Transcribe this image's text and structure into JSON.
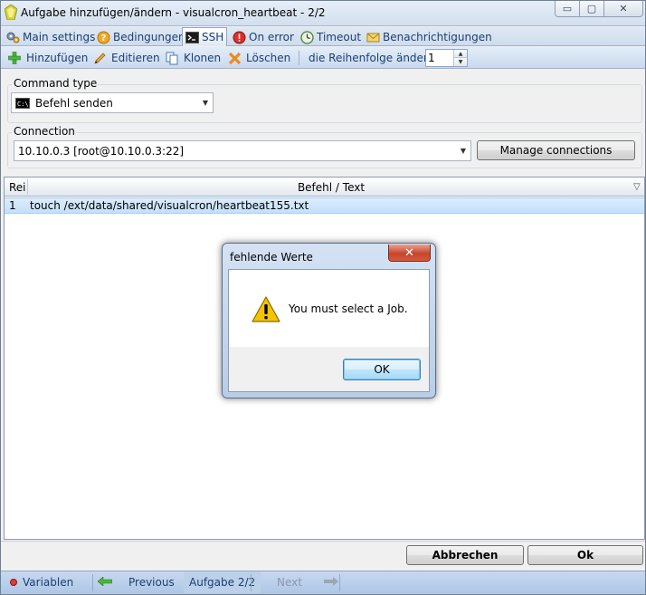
{
  "window": {
    "title": "Aufgabe hinzufügen/ändern - visualcron_heartbeat - 2/2",
    "min_glyph": "▭",
    "max_glyph": "▢",
    "close_glyph": "✕"
  },
  "tabs": [
    {
      "label": "Main settings",
      "icon": "gears-icon"
    },
    {
      "label": "Bedingungen",
      "icon": "question-icon"
    },
    {
      "label": "SSH",
      "icon": "terminal-icon",
      "active": true
    },
    {
      "label": "On error",
      "icon": "error-icon"
    },
    {
      "label": "Timeout",
      "icon": "clock-icon"
    },
    {
      "label": "Benachrichtigungen",
      "icon": "envelope-icon"
    }
  ],
  "toolbar": {
    "add_label": "Hinzufügen",
    "edit_label": "Editieren",
    "clone_label": "Klonen",
    "delete_label": "Löschen",
    "order_label": "die Reihenfolge ändern",
    "order_value": "1",
    "spin_up": "▲",
    "spin_down": "▼"
  },
  "command_type": {
    "label": "Command type",
    "value": "Befehl senden",
    "icon_text": "C:\\"
  },
  "connection": {
    "label": "Connection",
    "value": "10.10.0.3 [root@10.10.0.3:22]",
    "manage_label": "Manage connections"
  },
  "grid": {
    "columns": [
      "Rei",
      "Befehl / Text"
    ],
    "rows": [
      {
        "index": "1",
        "text": "touch /ext/data/shared/visualcron/heartbeat155.txt"
      }
    ],
    "filter_glyph": "▽"
  },
  "buttons": {
    "cancel_label": "Abbrechen",
    "ok_label": "Ok"
  },
  "statusbar": {
    "variables_label": "Variablen",
    "previous_label": "Previous",
    "task_label": "Aufgabe 2/2",
    "next_label": "Next"
  },
  "dialog": {
    "title": "fehlende Werte",
    "message": "You must select a Job.",
    "ok_label": "OK",
    "close_glyph": "✕"
  },
  "colors": {
    "accent": "#1b3f73",
    "selection": "#c4e0fb",
    "warning": "#f5c400",
    "close_red": "#c8452c"
  }
}
